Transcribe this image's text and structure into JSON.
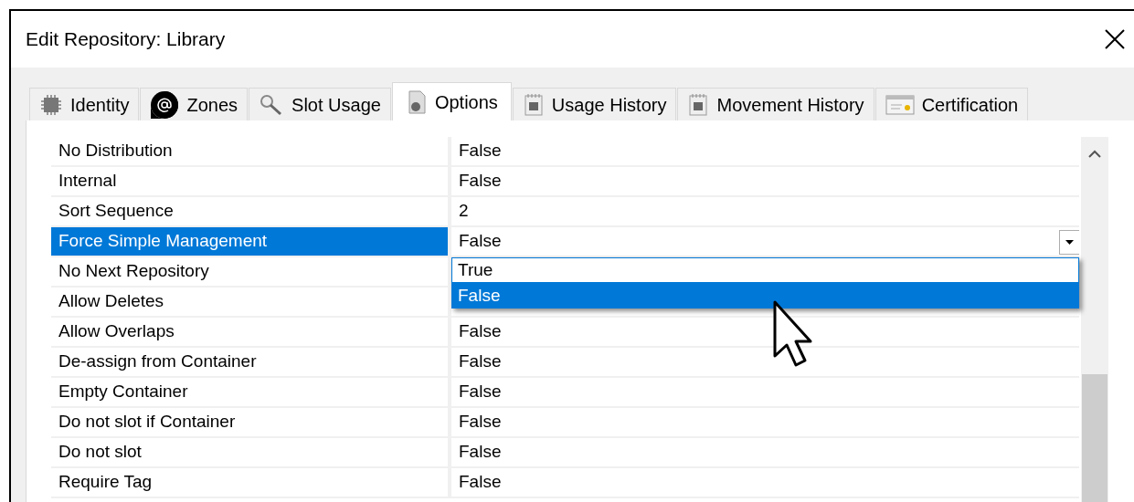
{
  "window": {
    "title": "Edit Repository: Library"
  },
  "tabs": [
    {
      "label": "Identity",
      "selected": false
    },
    {
      "label": "Zones",
      "selected": false
    },
    {
      "label": "Slot Usage",
      "selected": false
    },
    {
      "label": "Options",
      "selected": true
    },
    {
      "label": "Usage History",
      "selected": false
    },
    {
      "label": "Movement History",
      "selected": false
    },
    {
      "label": "Certification",
      "selected": false
    }
  ],
  "properties": [
    {
      "name": "No Distribution",
      "value": "False",
      "selected": false
    },
    {
      "name": "Internal",
      "value": "False",
      "selected": false
    },
    {
      "name": "Sort Sequence",
      "value": "2",
      "selected": false
    },
    {
      "name": "Force Simple Management",
      "value": "False",
      "selected": true,
      "editor": {
        "expanded": true,
        "options": [
          {
            "label": "True",
            "selected": false
          },
          {
            "label": "False",
            "selected": true
          }
        ]
      }
    },
    {
      "name": "No Next Repository",
      "selected": false
    },
    {
      "name": "Allow Deletes",
      "selected": false
    },
    {
      "name": "Allow Overlaps",
      "value": "False",
      "selected": false
    },
    {
      "name": "De-assign from Container",
      "value": "False",
      "selected": false
    },
    {
      "name": "Empty Container",
      "value": "False",
      "selected": false
    },
    {
      "name": "Do not slot if Container",
      "value": "False",
      "selected": false
    },
    {
      "name": "Do not slot",
      "value": "False",
      "selected": false
    },
    {
      "name": "Require Tag",
      "value": "False",
      "selected": false
    }
  ]
}
